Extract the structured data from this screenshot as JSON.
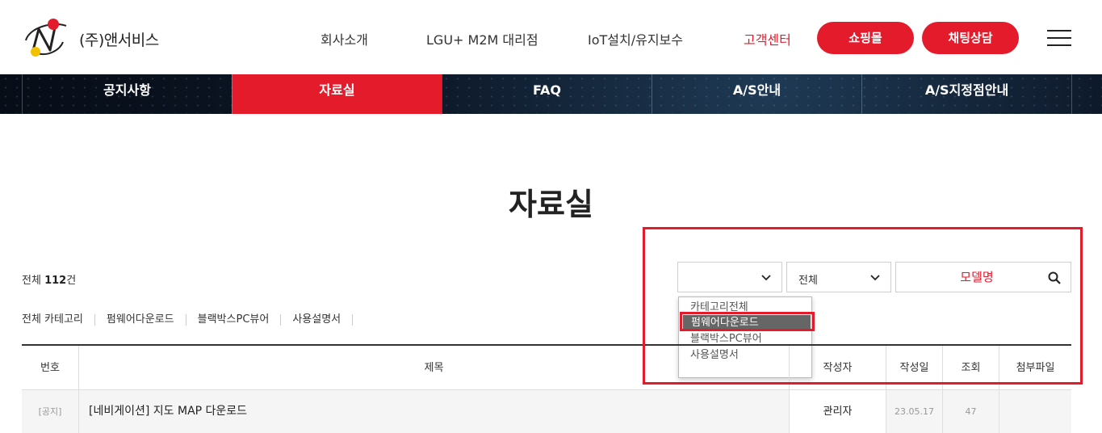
{
  "brand": {
    "name": "(주)앤서비스",
    "logo_letter": "N"
  },
  "nav": {
    "items": [
      "회사소개",
      "LGU+ M2M 대리점",
      "IoT설치/유지보수",
      "고객센터"
    ],
    "active_index": 3,
    "shop_label": "쇼핑몰",
    "chat_label": "채팅상담"
  },
  "tabs": [
    "공지사항",
    "자료실",
    "FAQ",
    "A/S안내",
    "A/S지정점안내"
  ],
  "active_tab": 1,
  "page_title": "자료실",
  "total": {
    "prefix": "전체 ",
    "count": "112",
    "suffix": "건"
  },
  "categories": [
    "전체 카테고리",
    "펌웨어다운로드",
    "블랙박스PC뷰어",
    "사용설명서"
  ],
  "filters": {
    "category_value": "",
    "field_value": "전체",
    "search_placeholder": "모델명"
  },
  "dropdown_options": [
    "카테고리전체",
    "펌웨어다운로드",
    "블랙박스PC뷰어",
    "사용설명서"
  ],
  "dropdown_selected_index": 1,
  "table": {
    "headers": [
      "번호",
      "제목",
      "작성자",
      "작성일",
      "조회",
      "첨부파일"
    ],
    "rows": [
      {
        "number": "[공지]",
        "title": "[네비게이션] 지도 MAP 다운로드",
        "author": "관리자",
        "date": "23.05.17",
        "views": "47",
        "attachment": ""
      }
    ]
  },
  "colors": {
    "accent": "#e31b2b",
    "tabbar": "#0d1828"
  }
}
